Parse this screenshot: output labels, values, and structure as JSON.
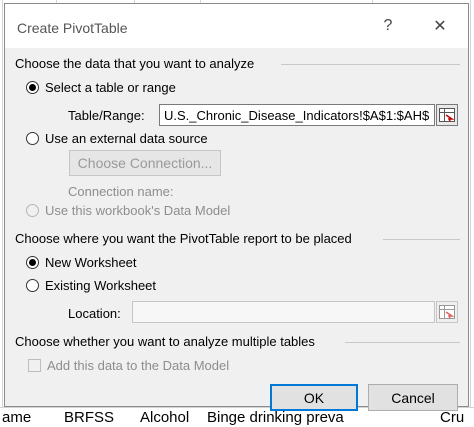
{
  "dialog": {
    "title": "Create PivotTable",
    "help_label": "?",
    "close_label": "✕"
  },
  "analyze": {
    "heading": "Choose the data that you want to analyze",
    "select_table_label": "Select a table or range",
    "table_range_label": "Table/Range:",
    "table_range_value": "U.S._Chronic_Disease_Indicators!$A$1:$AH$",
    "external_source_label": "Use an external data source",
    "choose_connection_label": "Choose Connection...",
    "connection_name_label": "Connection name:",
    "data_model_label": "Use this workbook's Data Model"
  },
  "placement": {
    "heading": "Choose where you want the PivotTable report to be placed",
    "new_worksheet_label": "New Worksheet",
    "existing_worksheet_label": "Existing Worksheet",
    "location_label": "Location:",
    "location_value": ""
  },
  "multiple": {
    "heading": "Choose whether you want to analyze multiple tables",
    "add_data_model_label": "Add this data to the Data Model"
  },
  "buttons": {
    "ok": "OK",
    "cancel": "Cancel"
  },
  "background": {
    "row_cells": [
      "ame",
      "BRFSS",
      "Alcohol",
      "Binge drinking preva",
      "Cru"
    ]
  }
}
